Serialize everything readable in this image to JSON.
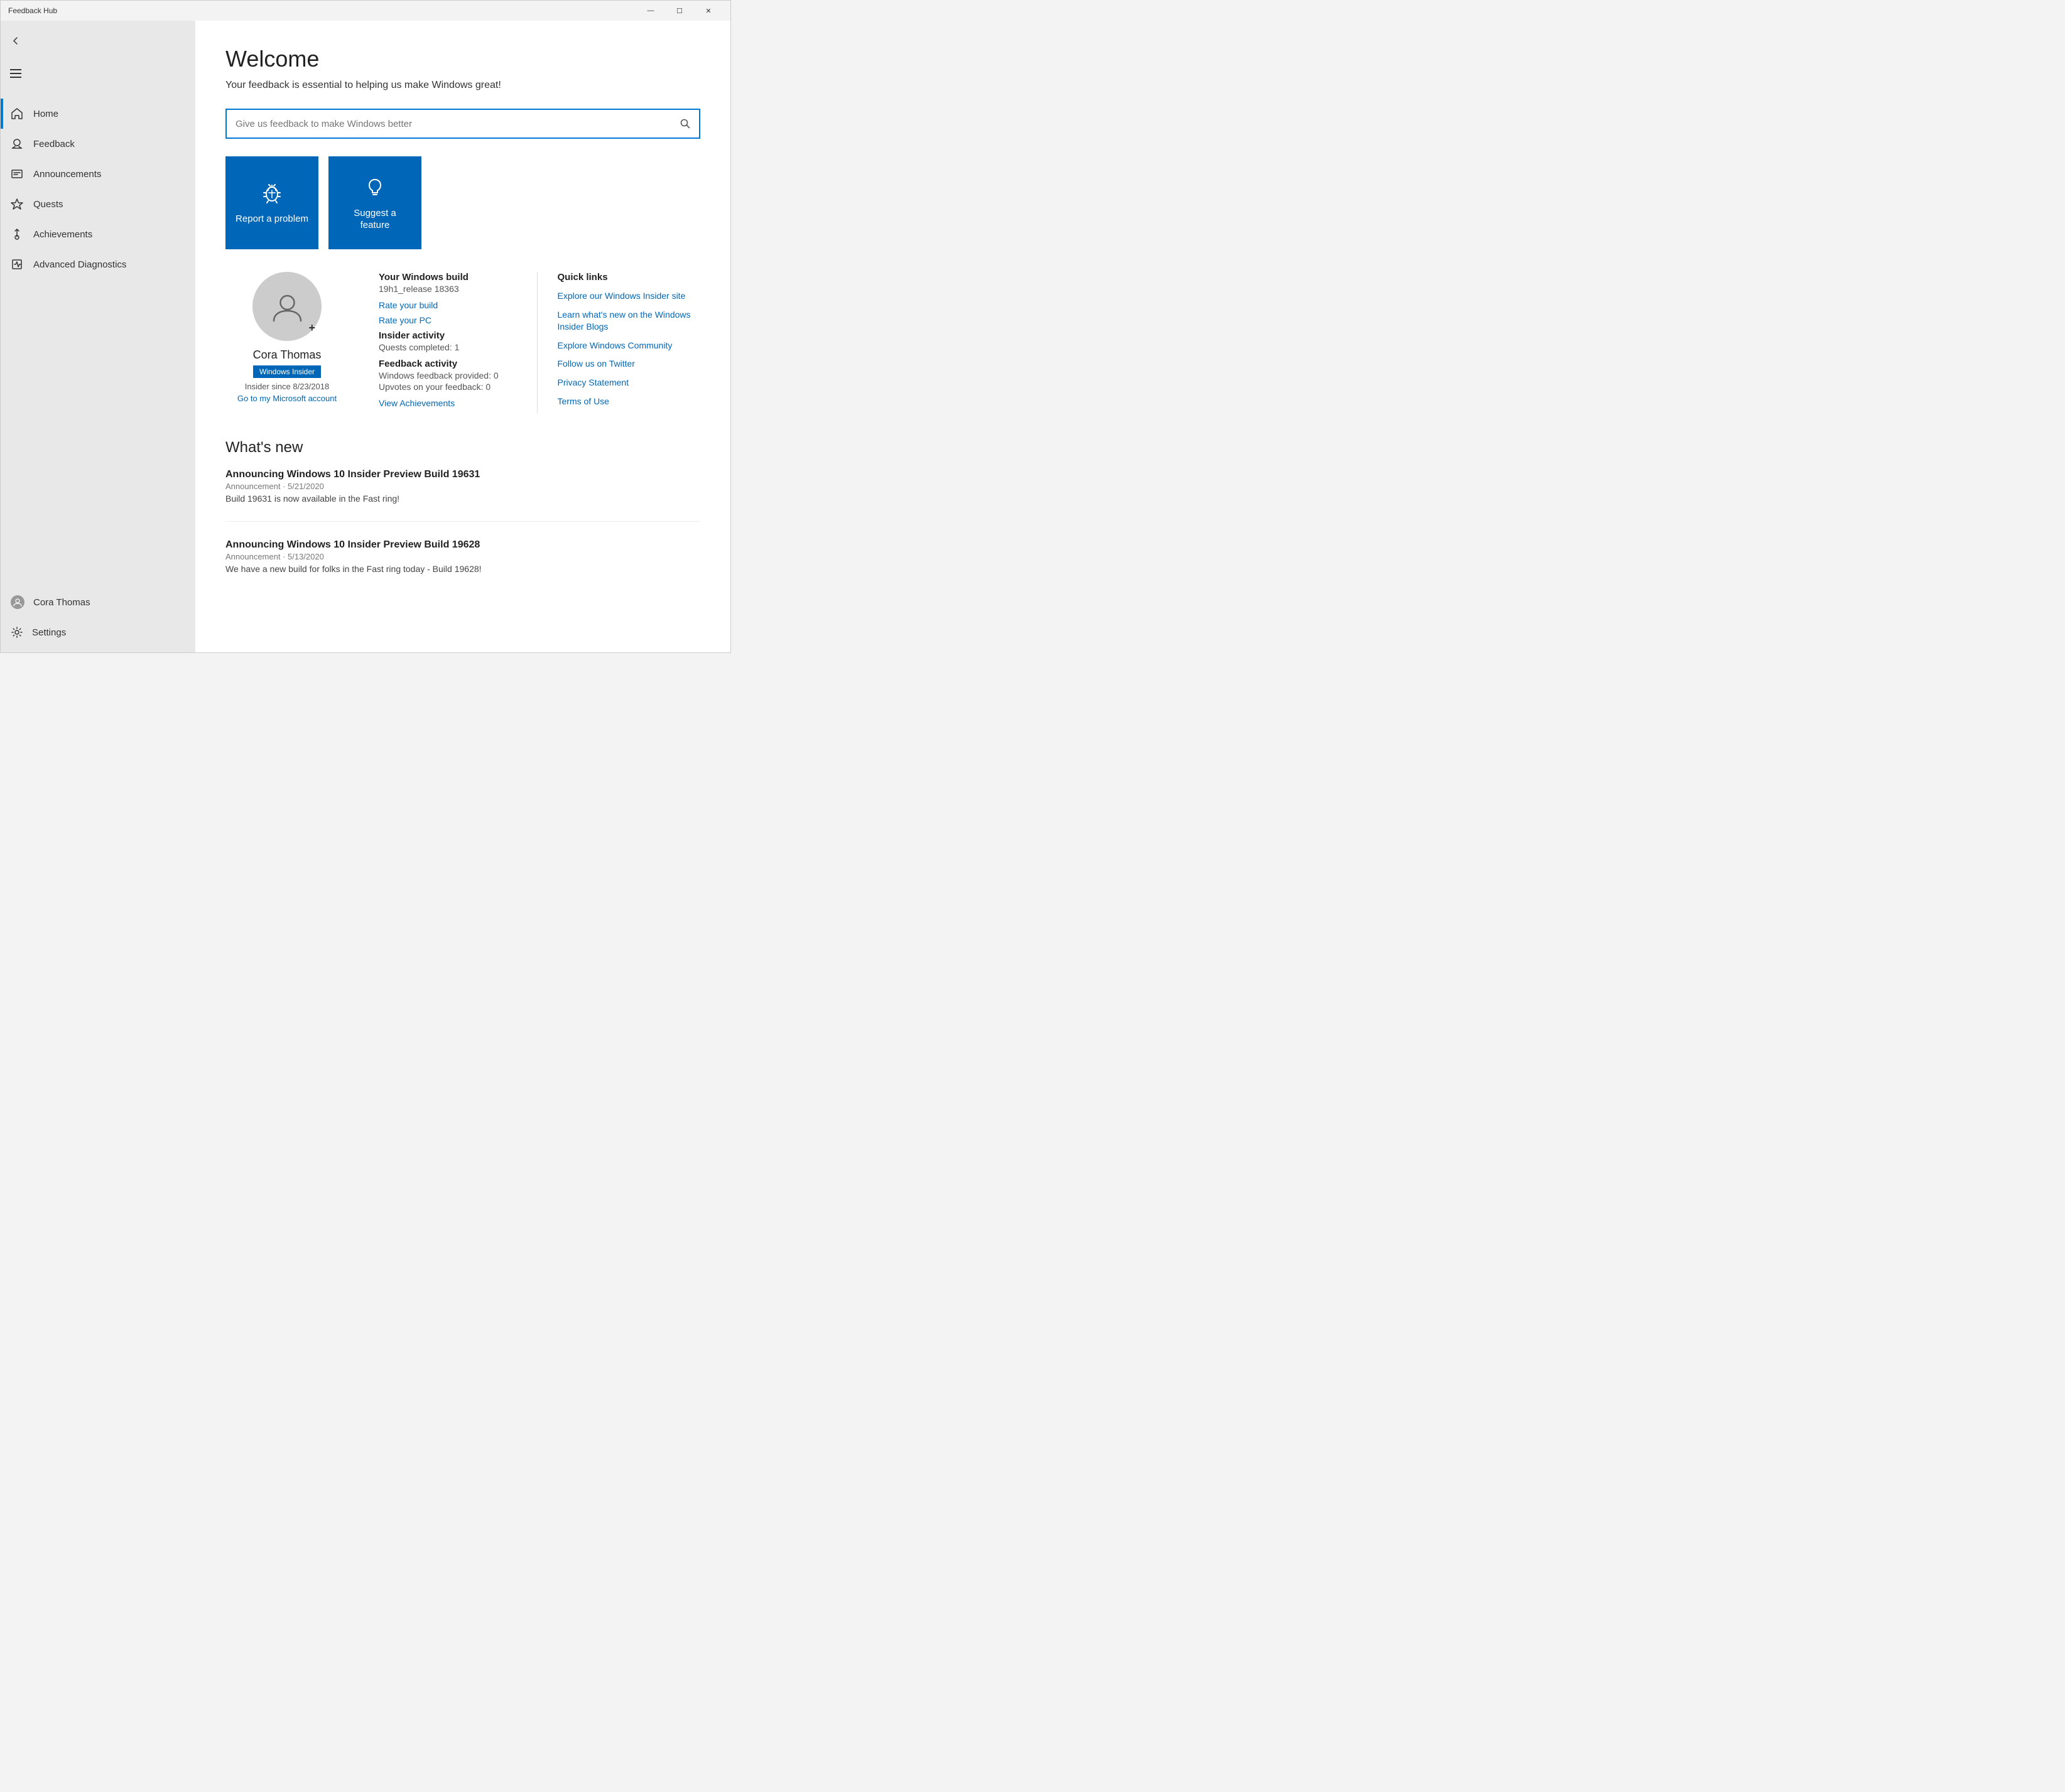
{
  "titleBar": {
    "title": "Feedback Hub",
    "minimizeLabel": "—",
    "maximizeLabel": "☐",
    "closeLabel": "✕"
  },
  "sidebar": {
    "backIcon": "←",
    "hamburgerAriaLabel": "Menu",
    "navItems": [
      {
        "id": "home",
        "label": "Home",
        "active": true
      },
      {
        "id": "feedback",
        "label": "Feedback",
        "active": false
      },
      {
        "id": "announcements",
        "label": "Announcements",
        "active": false
      },
      {
        "id": "quests",
        "label": "Quests",
        "active": false
      },
      {
        "id": "achievements",
        "label": "Achievements",
        "active": false
      },
      {
        "id": "diagnostics",
        "label": "Advanced Diagnostics",
        "active": false
      }
    ],
    "userLabel": "Cora Thomas",
    "settingsLabel": "Settings"
  },
  "main": {
    "welcomeTitle": "Welcome",
    "welcomeSubtitle": "Your feedback is essential to helping us make Windows great!",
    "searchPlaceholder": "Give us feedback to make Windows better",
    "tiles": [
      {
        "id": "report",
        "label": "Report a problem"
      },
      {
        "id": "suggest",
        "label": "Suggest a feature"
      }
    ],
    "profile": {
      "name": "Cora Thomas",
      "badge": "Windows Insider",
      "insiderSince": "Insider since 8/23/2018",
      "accountLink": "Go to my Microsoft account"
    },
    "buildInfo": {
      "buildTitle": "Your Windows build",
      "buildValue": "19h1_release 18363",
      "rateYourBuild": "Rate your build",
      "rateYourPC": "Rate your PC",
      "insiderActivityTitle": "Insider activity",
      "questsCompleted": "Quests completed: 1",
      "feedbackActivityTitle": "Feedback activity",
      "windowsFeedback": "Windows feedback provided: 0",
      "upvotes": "Upvotes on your feedback: 0",
      "viewAchievements": "View Achievements"
    },
    "quickLinks": {
      "title": "Quick links",
      "links": [
        "Explore our Windows Insider site",
        "Learn what's new on the Windows Insider Blogs",
        "Explore Windows Community",
        "Follow us on Twitter",
        "Privacy Statement",
        "Terms of Use"
      ]
    },
    "whatsNew": {
      "title": "What's new",
      "items": [
        {
          "title": "Announcing Windows 10 Insider Preview Build 19631",
          "meta": "Announcement  ·  5/21/2020",
          "desc": "Build 19631 is now available in the Fast ring!"
        },
        {
          "title": "Announcing Windows 10 Insider Preview Build 19628",
          "meta": "Announcement  ·  5/13/2020",
          "desc": "We have a new build for folks in the Fast ring today - Build 19628!"
        }
      ]
    }
  }
}
